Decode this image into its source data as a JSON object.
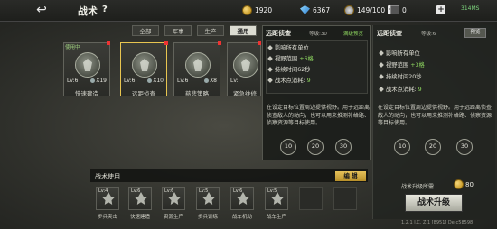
{
  "topbar": {
    "back_icon": "back-arrow-icon",
    "title": "战术",
    "help": "?",
    "gold": "1920",
    "diamond": "6367",
    "fuel": "149/100",
    "other": "0",
    "signal": "314MS"
  },
  "tabs": [
    {
      "label": "全部",
      "active": false
    },
    {
      "label": "军事",
      "active": false
    },
    {
      "label": "生产",
      "active": false
    },
    {
      "label": "通用",
      "active": true
    }
  ],
  "cards": {
    "in_use_label": "使用中",
    "items": [
      {
        "label": "快速建造",
        "lv": "Lv:6",
        "count": "X19"
      },
      {
        "label": "远距侦查",
        "lv": "Lv:6",
        "count": "X10"
      },
      {
        "label": "慈悲策略",
        "lv": "Lv:6",
        "count": "X8"
      },
      {
        "label": "紧急维修",
        "lv": "Lv:",
        "count": ""
      }
    ]
  },
  "popup": {
    "name": "远距侦查",
    "level": "等级:30",
    "status": "满级预览",
    "effects": [
      {
        "text": "影响所有单位",
        "value": ""
      },
      {
        "text": "视野范围",
        "value": "+6格"
      },
      {
        "text": "持续时间62秒",
        "value": ""
      },
      {
        "text": "战术点消耗:",
        "value": "9"
      }
    ],
    "desc": "在设定目标位置周边提供视野。用于远距离侦查敌人的动向，也可以用来推测补给路、侦察资源等目标使用。",
    "circles": [
      "10",
      "20",
      "30"
    ]
  },
  "right_panel": {
    "name": "远距侦查",
    "level": "等级:6",
    "preview": "预览",
    "effects": [
      {
        "text": "影响所有单位",
        "value": ""
      },
      {
        "text": "视野范围",
        "value": "+3格"
      },
      {
        "text": "持续时间20秒",
        "value": ""
      },
      {
        "text": "战术点消耗:",
        "value": "9"
      }
    ],
    "desc": "在设定目标位置周边提供视野。用于远距离侦查敌人的动向，也可以用来推测补给路、侦察资源等目标使用。",
    "circles": [
      "10",
      "20",
      "30"
    ],
    "cost_label": "战术升级所需",
    "cost": "80",
    "upgrade_label": "战术升级",
    "footer": "1.2.1 I.C. ZJ1 [8951] De:c58598"
  },
  "tactical_bar": {
    "title": "战术使用",
    "edit_label": "编 辑",
    "slots": [
      {
        "label": "步兵突击",
        "lv": "Lv:4"
      },
      {
        "label": "快速建造",
        "lv": "Lv:6"
      },
      {
        "label": "资源生产",
        "lv": "Lv:6"
      },
      {
        "label": "步兵训练",
        "lv": "Lv:5"
      },
      {
        "label": "战车机动",
        "lv": "Lv:6"
      },
      {
        "label": "战车生产",
        "lv": "Lv:5"
      },
      {
        "label": "",
        "lv": ""
      },
      {
        "label": "",
        "lv": ""
      }
    ]
  }
}
